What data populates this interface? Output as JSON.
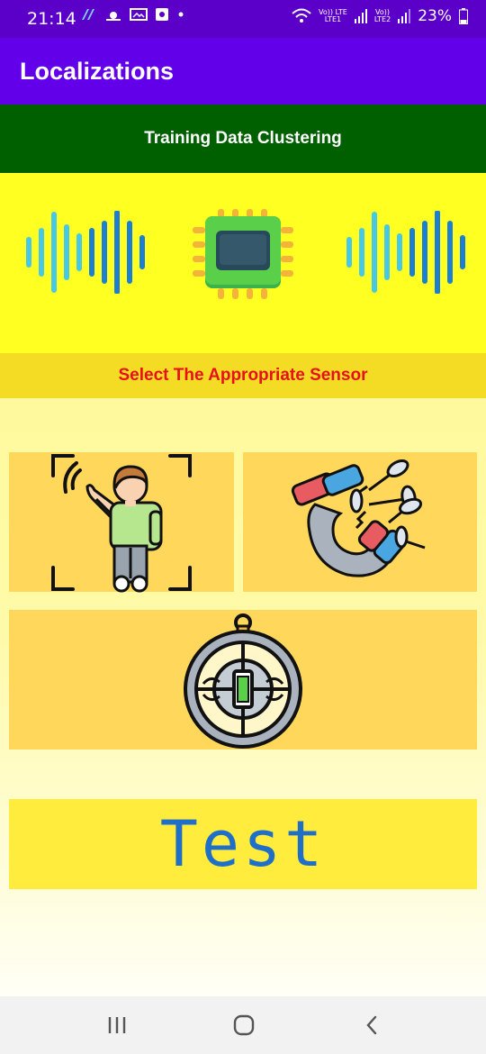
{
  "status_bar": {
    "time": "21:14",
    "sim1": "Vo)) LTE\nLTE1",
    "sim1_label": "LTE1",
    "sim2_label": "LTE2",
    "battery": "23%"
  },
  "app_bar": {
    "title": "Localizations"
  },
  "banner": {
    "text": "Training Data Clustering"
  },
  "prompt": {
    "text": "Select The Appropriate Sensor"
  },
  "sensors": [
    {
      "name": "motion-sensor"
    },
    {
      "name": "magnetometer"
    },
    {
      "name": "compass"
    }
  ],
  "test": {
    "label": "Test"
  },
  "colors": {
    "status_bar": "#5a00c8",
    "app_bar": "#6200ea",
    "banner": "#006000",
    "hero": "#ffff22",
    "prompt_bg": "#f4dc24",
    "prompt_text": "#e8101a",
    "card": "#ffd75a",
    "test_card": "#ffec3c",
    "test_text": "#1f6fc8"
  },
  "nav": {
    "recents_icon": "recents-icon",
    "home_icon": "home-icon",
    "back_icon": "back-icon"
  }
}
